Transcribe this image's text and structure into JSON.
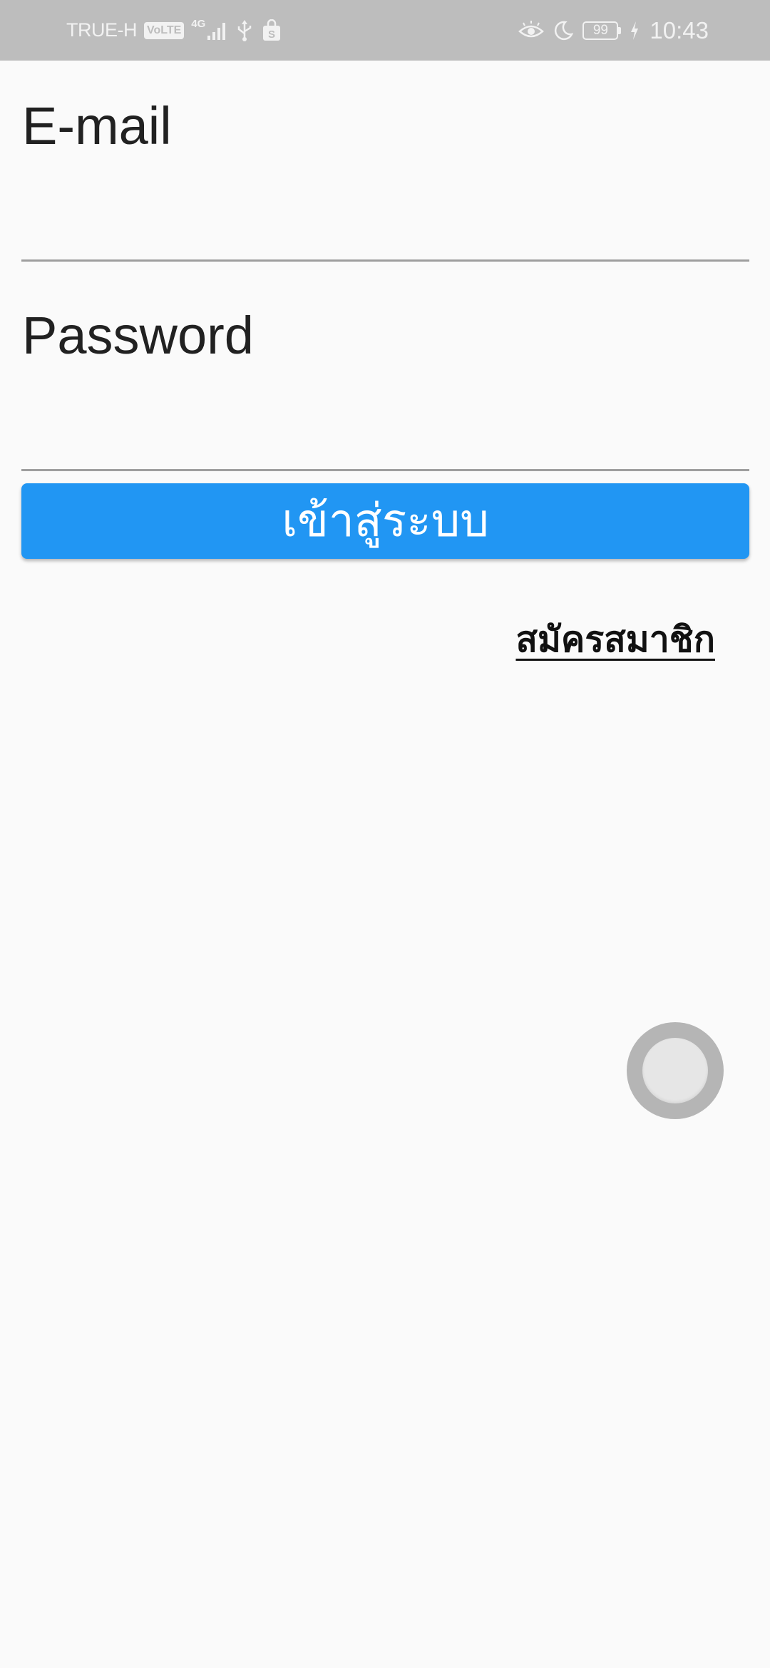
{
  "status_bar": {
    "carrier": "TRUE-H",
    "volte": "VoLTE",
    "network_type": "4G",
    "battery": "99",
    "time": "10:43",
    "icons": [
      "signal-icon",
      "usb-icon",
      "shopping-bag-icon",
      "eye-comfort-icon",
      "moon-icon",
      "battery-icon",
      "charging-icon"
    ]
  },
  "form": {
    "email_label": "E-mail",
    "email_value": "",
    "password_label": "Password",
    "password_value": "",
    "login_button": "เข้าสู่ระบบ",
    "register_link": "สมัครสมาชิก"
  },
  "colors": {
    "primary": "#2196f3",
    "background": "#fafafa",
    "status_bar": "#bdbdbd",
    "text": "#212121",
    "underline": "#9e9e9e"
  }
}
